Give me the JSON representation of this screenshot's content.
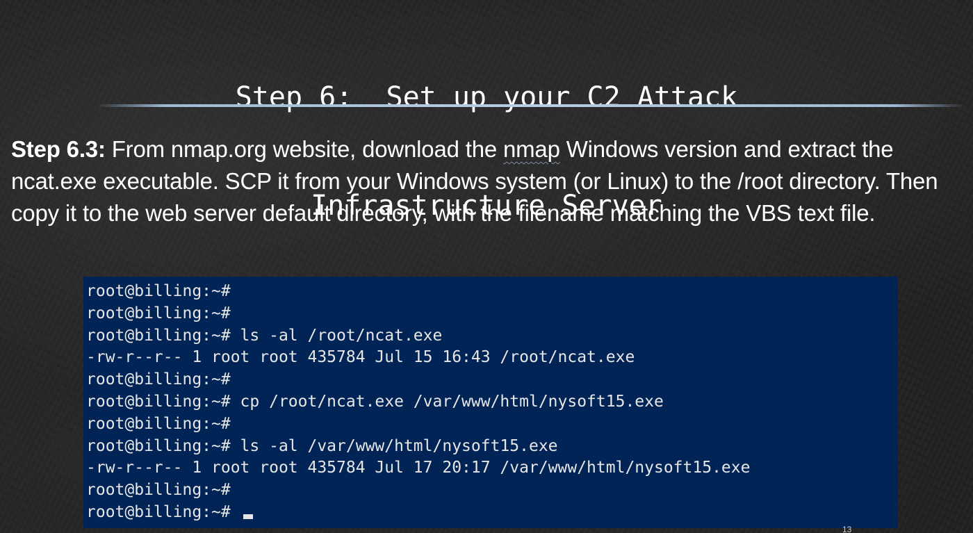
{
  "slide": {
    "title_lines": [
      "Step 6:  Set up your C2 Attack",
      "Infrastructure Server"
    ],
    "body": {
      "step_label": "Step 6.3:",
      "text_before_nmap": " From nmap.org website, download the ",
      "squiggle_word": "nmap",
      "text_after_nmap": " Windows version and extract the ncat.exe executable.  SCP it from your Windows system (or Linux) to the /root directory.  Then copy it to the web server default directory, with the filename matching the VBS text file."
    },
    "page_number": "13"
  },
  "terminal": {
    "background": "#012456",
    "text_color": "#e6e6e6",
    "lines": [
      "root@billing:~#",
      "root@billing:~#",
      "root@billing:~# ls -al /root/ncat.exe",
      "-rw-r--r-- 1 root root 435784 Jul 15 16:43 /root/ncat.exe",
      "root@billing:~#",
      "root@billing:~# cp /root/ncat.exe /var/www/html/nysoft15.exe",
      "root@billing:~#",
      "root@billing:~# ls -al /var/www/html/nysoft15.exe",
      "-rw-r--r-- 1 root root 435784 Jul 17 20:17 /var/www/html/nysoft15.exe",
      "root@billing:~#",
      "root@billing:~# "
    ]
  }
}
